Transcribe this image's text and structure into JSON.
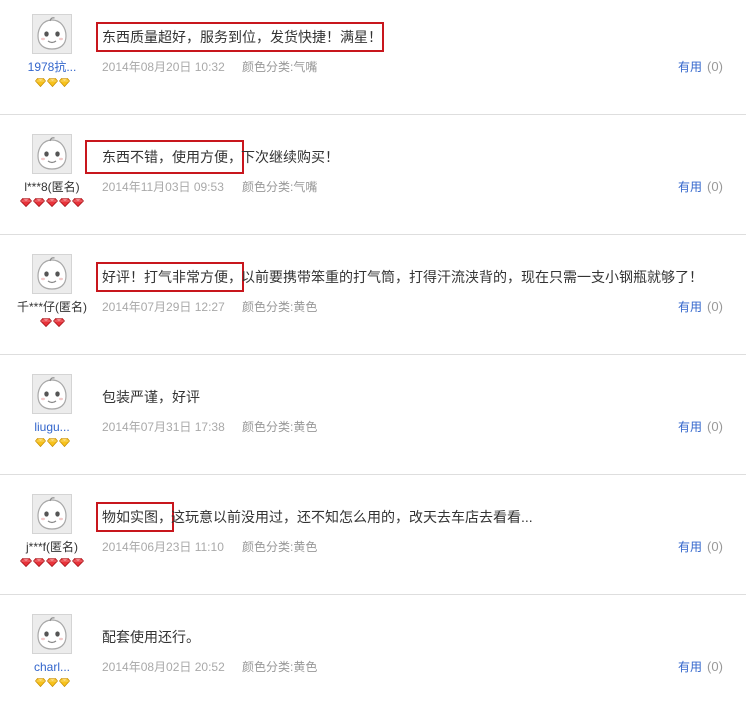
{
  "colors": {
    "link": "#3366cc",
    "highlight_box": "#c8161d",
    "gold_diamond": "#f7c21b",
    "gold_diamond_edge": "#c98f00",
    "red_diamond": "#e8333a",
    "red_diamond_edge": "#a8141a"
  },
  "reviews": [
    {
      "username": "1978抗...",
      "badge": {
        "type": "gold",
        "count": 3
      },
      "comment_highlighted": "东西质量超好，服务到位，发货快捷！满星！",
      "date": "2014年08月20日 10:32",
      "spec": "颜色分类:气嘴",
      "useful_label": "有用",
      "useful_count": "(0)"
    },
    {
      "username": "l***8(匿名)",
      "badge": {
        "type": "red",
        "count": 5
      },
      "comment_highlighted": "东西不错，使用方便，",
      "comment_plain": "下次继续购买！",
      "date": "2014年11月03日 09:53",
      "spec": "颜色分类:气嘴",
      "useful_label": "有用",
      "useful_count": "(0)"
    },
    {
      "username": "千***仔(匿名)",
      "badge": {
        "type": "red",
        "count": 2
      },
      "comment_highlighted": "好评！打气非常方便，",
      "comment_plain": "以前要携带笨重的打气筒，打得汗流浃背的，现在只需一支小钢瓶就够了！",
      "date": "2014年07月29日 12:27",
      "spec": "颜色分类:黄色",
      "useful_label": "有用",
      "useful_count": "(0)"
    },
    {
      "username": "liugu...",
      "badge": {
        "type": "gold",
        "count": 3
      },
      "comment_plain": "包装严谨，好评",
      "date": "2014年07月31日 17:38",
      "spec": "颜色分类:黄色",
      "useful_label": "有用",
      "useful_count": "(0)"
    },
    {
      "username": "j***f(匿名)",
      "badge": {
        "type": "red",
        "count": 5
      },
      "comment_highlighted": "物如实图，",
      "comment_plain": "这玩意以前没用过，还不知怎么用的，改天去车店去看看...",
      "date": "2014年06月23日 11:10",
      "spec": "颜色分类:黄色",
      "useful_label": "有用",
      "useful_count": "(0)"
    },
    {
      "username": "charl...",
      "badge": {
        "type": "gold",
        "count": 3
      },
      "comment_plain": "配套使用还行。",
      "date": "2014年08月02日 20:52",
      "spec": "颜色分类:黄色",
      "useful_label": "有用",
      "useful_count": "(0)"
    }
  ]
}
